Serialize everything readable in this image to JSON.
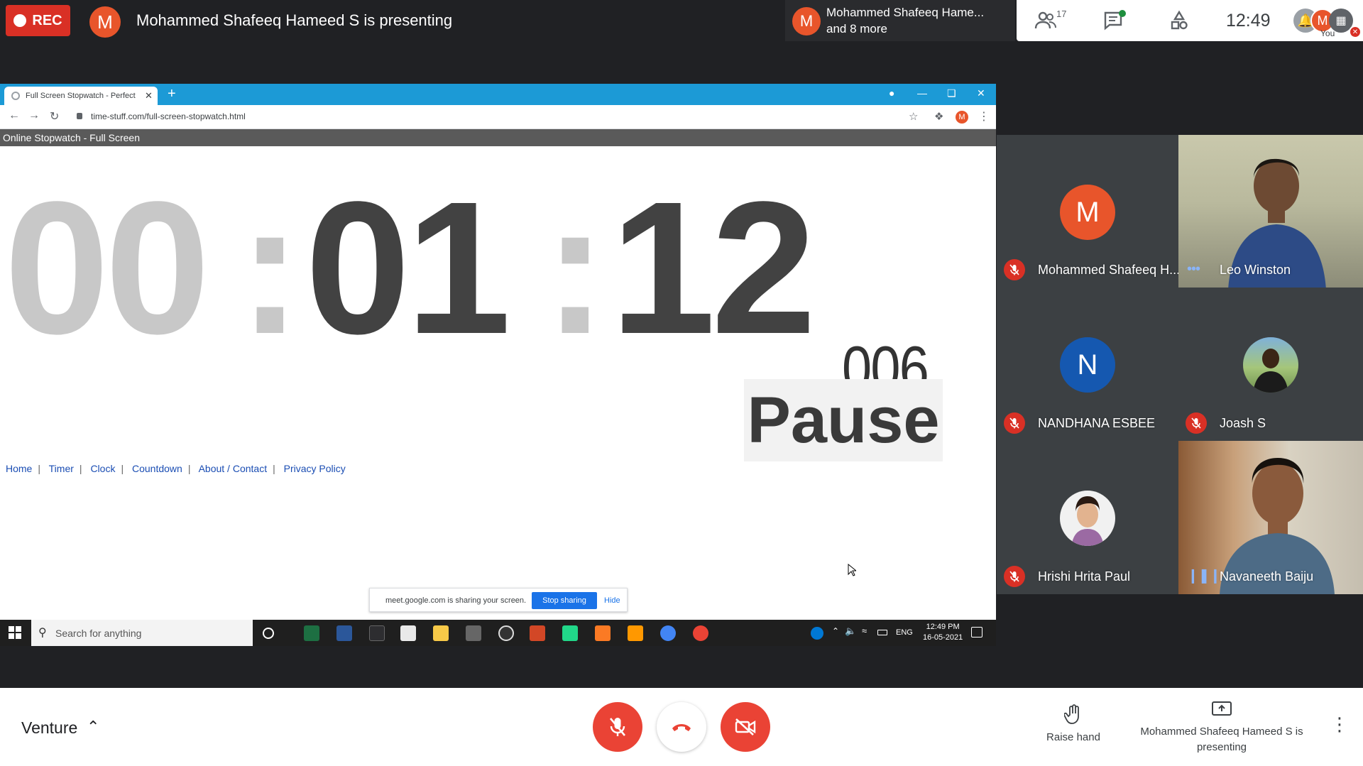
{
  "topbar": {
    "rec_label": "REC",
    "presenter_initial": "M",
    "presenter_text": "Mohammed Shafeeq Hameed S is presenting",
    "pinned_initial": "M",
    "pinned_name": "Mohammed Shafeeq Hame...",
    "pinned_more": "and 8 more",
    "people_count": "17",
    "clock": "12:49",
    "you_initial": "M",
    "you_label": "You"
  },
  "browser": {
    "tab_title": "Full Screen Stopwatch - Perfect",
    "url": "time-stuff.com/full-screen-stopwatch.html",
    "profile_initial": "M"
  },
  "site": {
    "header_title": "Online Stopwatch - Full Screen",
    "stopwatch": {
      "hours": "00",
      "minutes": "01",
      "seconds": "12",
      "millis": "006",
      "separator": ":"
    },
    "pause_label": "Pause",
    "links": [
      "Home",
      "Timer",
      "Clock",
      "Countdown",
      "About / Contact",
      "Privacy Policy"
    ]
  },
  "share_banner": {
    "text": "meet.google.com is sharing your screen.",
    "stop_label": "Stop sharing",
    "hide_label": "Hide"
  },
  "taskbar": {
    "search_placeholder": "Search for anything",
    "language": "ENG",
    "time": "12:49 PM",
    "date": "16-05-2021"
  },
  "participants": [
    {
      "name": "Mohammed Shafeeq H...",
      "initial": "M",
      "avatar_color": "#e8552b",
      "status": "muted"
    },
    {
      "name": "Leo Winston",
      "initial": "",
      "status": "active"
    },
    {
      "name": "NANDHANA ESBEE",
      "initial": "N",
      "avatar_color": "#1558b0",
      "status": "muted"
    },
    {
      "name": "Joash S",
      "initial": "",
      "status": "muted"
    },
    {
      "name": "Hrishi Hrita Paul",
      "initial": "",
      "status": "muted"
    },
    {
      "name": "Navaneeth Baiju",
      "initial": "",
      "status": "speaking"
    }
  ],
  "bottombar": {
    "meeting_name": "Venture",
    "raise_hand_label": "Raise hand",
    "present_label": "Mohammed Shafeeq Hameed S is presenting"
  },
  "colors": {
    "meet_red": "#ea4335",
    "avatar_orange": "#e8552b",
    "avatar_blue": "#1558b0",
    "chrome_blue": "#1c9ad6",
    "stop_sharing_blue": "#1a73e8"
  }
}
